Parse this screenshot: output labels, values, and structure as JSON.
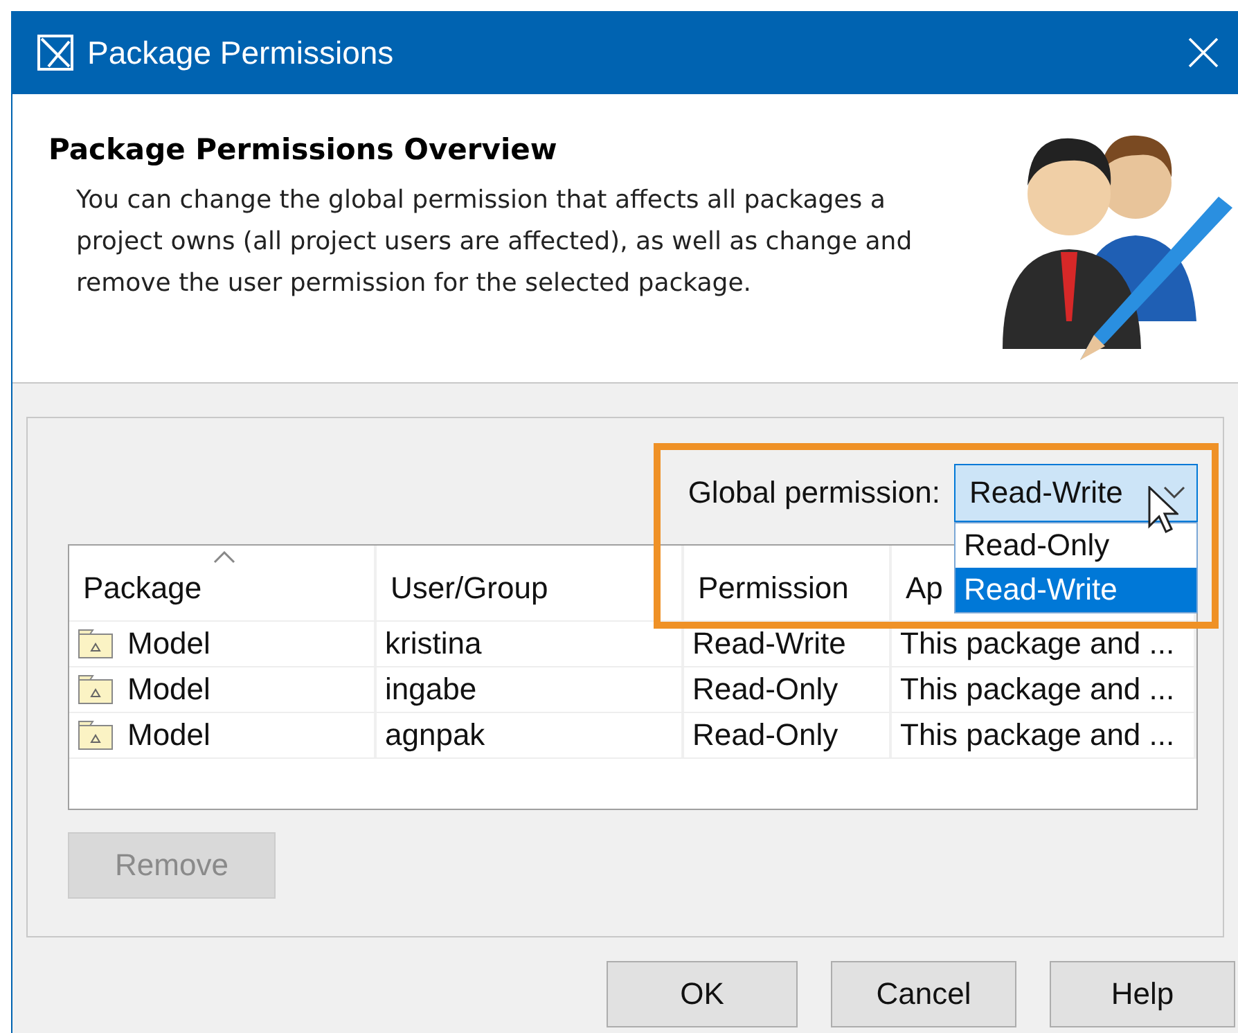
{
  "window": {
    "title": "Package Permissions"
  },
  "header": {
    "title": "Package Permissions Overview",
    "description": "You can change the global permission that affects all packages a project owns (all project users are affected), as well as change and remove the user permission for the selected package."
  },
  "global_permission": {
    "label": "Global permission:",
    "value": "Read-Write",
    "expanded": true,
    "options": [
      {
        "label": "Read-Only",
        "selected": false
      },
      {
        "label": "Read-Write",
        "selected": true
      }
    ]
  },
  "table": {
    "columns": [
      {
        "label": "Package",
        "sorted": true
      },
      {
        "label": "User/Group",
        "sorted": false
      },
      {
        "label": "Permission",
        "sorted": false
      },
      {
        "label": "Ap",
        "sorted": false
      }
    ],
    "rows": [
      {
        "package": "Model",
        "user": "kristina",
        "permission": "Read-Write",
        "applies_to": "This package and ..."
      },
      {
        "package": "Model",
        "user": "ingabe",
        "permission": "Read-Only",
        "applies_to": "This package and ..."
      },
      {
        "package": "Model",
        "user": "agnpak",
        "permission": "Read-Only",
        "applies_to": "This package and ..."
      }
    ]
  },
  "remove_button": {
    "label": "Remove",
    "disabled": true
  },
  "buttons": [
    "OK",
    "Cancel",
    "Help"
  ]
}
